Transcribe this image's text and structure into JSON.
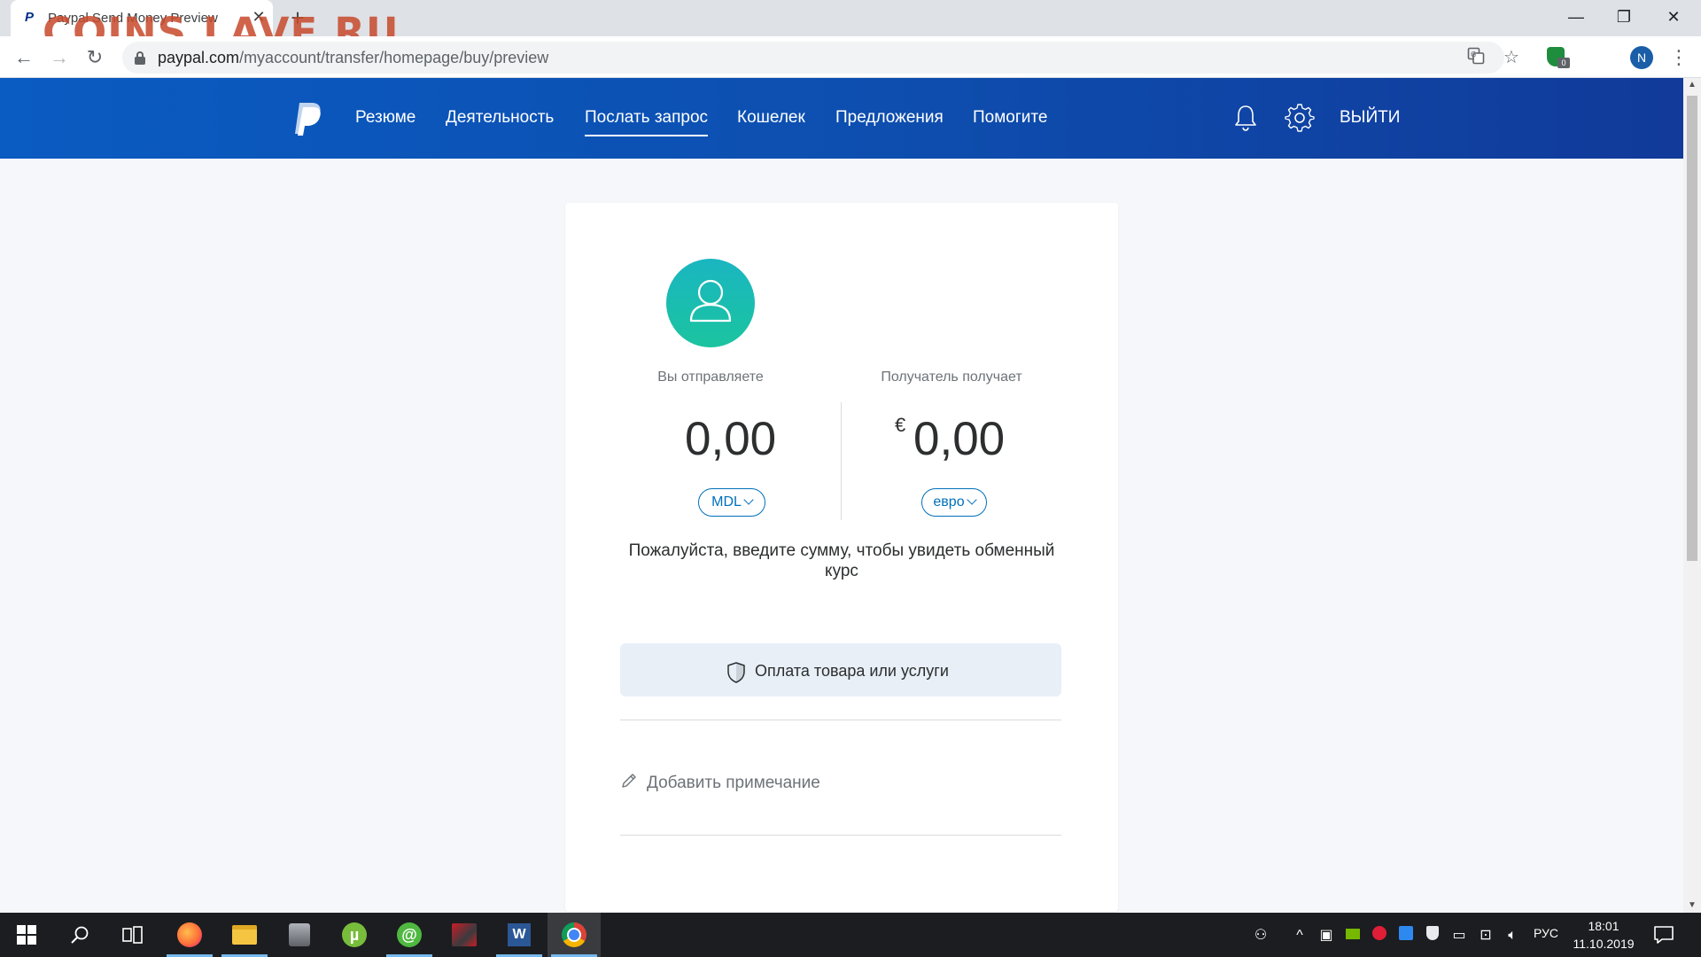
{
  "browser": {
    "tab_title": "Paypal Send Money Preview",
    "tab_favicon": "P",
    "tab_close": "✕",
    "new_tab": "+",
    "watermark": "COINS.LAVE.RU",
    "url_host": "paypal.com",
    "url_path": "/myaccount/transfer/homepage/buy/preview",
    "profile_initial": "N",
    "extension_badge": "0",
    "window_controls": {
      "minimize": "—",
      "restore": "❐",
      "close": "✕"
    },
    "nav": {
      "back": "←",
      "forward": "→",
      "reload": "↻"
    }
  },
  "paypal": {
    "nav_items": [
      {
        "label": "Резюме"
      },
      {
        "label": "Деятельность"
      },
      {
        "label": "Послать запрос",
        "active": true
      },
      {
        "label": "Кошелек"
      },
      {
        "label": "Предложения"
      },
      {
        "label": "Помогите"
      }
    ],
    "logout_label": "ВЫЙТИ",
    "send": {
      "you_send_label": "Вы отправляете",
      "recipient_gets_label": "Получатель получает",
      "send_amount": "0,00",
      "receive_amount": "0,00",
      "receive_currency_symbol": "€",
      "send_currency": "MDL",
      "receive_currency": "евро",
      "info_text": "Пожалуйста, введите сумму, чтобы увидеть обменный курс",
      "purpose_label": "Оплата товара или услуги",
      "add_note_label": "Добавить примечание"
    }
  },
  "taskbar": {
    "language": "РУС",
    "time": "18:01",
    "date": "11.10.2019"
  },
  "colors": {
    "paypal_blue": "#0070ba",
    "header_start": "#0a5bc2",
    "header_end": "#113a9a",
    "avatar_teal": "#1bc49f",
    "watermark": "#c74a2c"
  }
}
